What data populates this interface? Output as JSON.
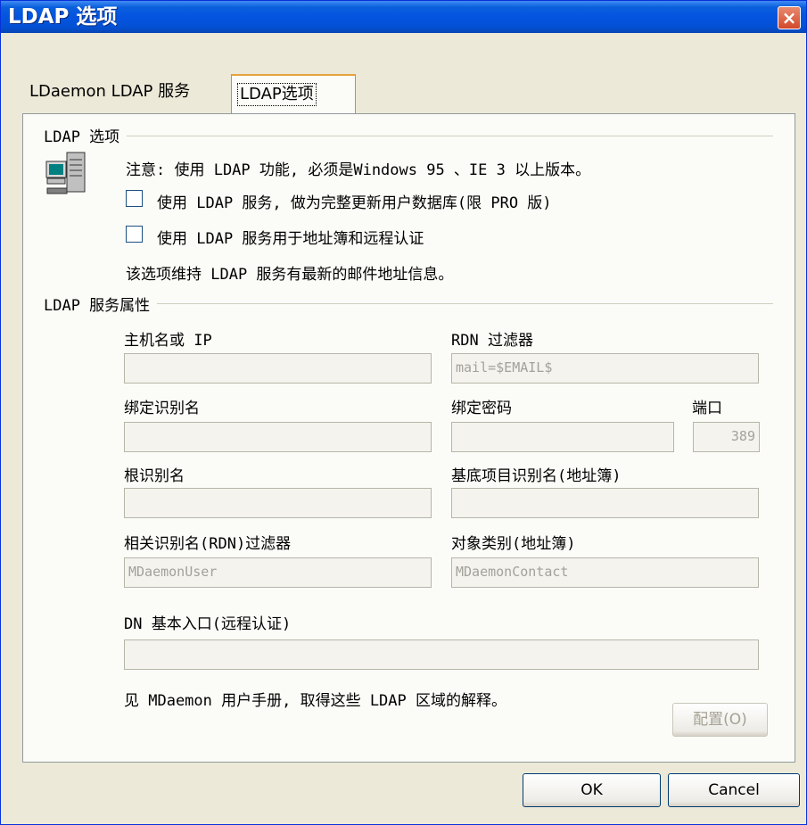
{
  "window": {
    "title": "LDAP 选项",
    "close_label": "×"
  },
  "tabs": [
    {
      "label": "LDaemon LDAP 服务"
    },
    {
      "label": "LDAP选项"
    }
  ],
  "options_group": {
    "title": "LDAP 选项",
    "note": "注意: 使用 LDAP 功能, 必须是Windows 95 、IE 3 以上版本。",
    "checkbox1": "使用 LDAP 服务, 做为完整更新用户数据库(限 PRO 版)",
    "checkbox2": "使用 LDAP 服务用于地址簿和远程认证",
    "info": "该选项维持 LDAP 服务有最新的邮件地址信息。"
  },
  "props_group": {
    "title": "LDAP 服务属性",
    "host_label": "主机名或 IP",
    "host_value": "",
    "rdn_filter_label": "RDN 过滤器",
    "rdn_filter_value": "mail=$EMAIL$",
    "bind_dn_label": "绑定识别名",
    "bind_dn_value": "",
    "bind_pw_label": "绑定密码",
    "bind_pw_value": "",
    "port_label": "端口",
    "port_value": "389",
    "root_dn_label": "根识别名",
    "root_dn_value": "",
    "base_entry_label": "基底项目识别名(地址簿)",
    "base_entry_value": "",
    "rdn_filter2_label": "相关识别名(RDN)过滤器",
    "rdn_filter2_value": "MDaemonUser",
    "object_class_label": "对象类别(地址簿)",
    "object_class_value": "MDaemonContact",
    "dn_entry_label": "DN 基本入口(远程认证)",
    "dn_entry_value": "",
    "manual_note": "见 MDaemon 用户手册, 取得这些 LDAP 区域的解释。",
    "config_label": "配置(O)"
  },
  "buttons": {
    "ok": "OK",
    "cancel": "Cancel"
  }
}
